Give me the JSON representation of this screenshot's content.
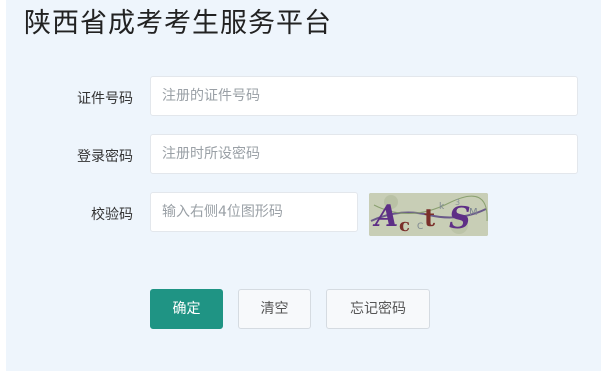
{
  "header": {
    "title": "陕西省成考考生服务平台"
  },
  "form": {
    "id_number": {
      "label": "证件号码",
      "placeholder": "注册的证件号码",
      "value": ""
    },
    "password": {
      "label": "登录密码",
      "placeholder": "注册时所设密码",
      "value": ""
    },
    "captcha": {
      "label": "校验码",
      "placeholder": "输入右侧4位图形码",
      "value": "",
      "image_text": "ActS"
    }
  },
  "buttons": {
    "confirm": "确定",
    "clear": "清空",
    "forgot_password": "忘记密码"
  },
  "colors": {
    "background": "#eef5fc",
    "primary": "#1f9484",
    "title": "#222222"
  }
}
